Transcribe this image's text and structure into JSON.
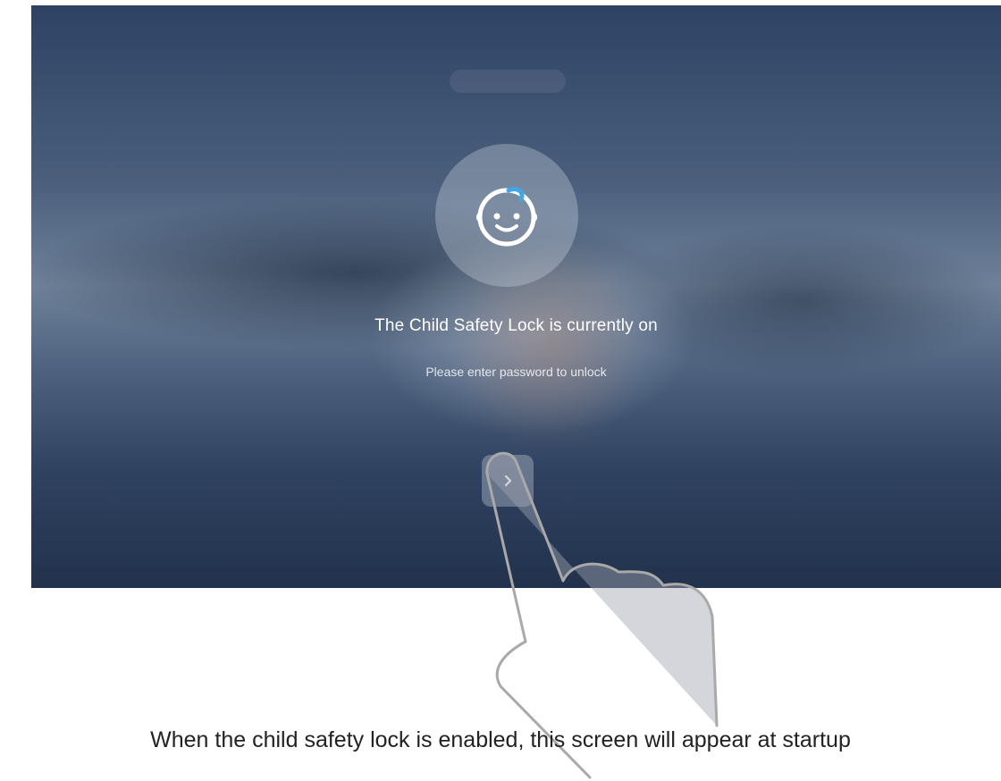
{
  "lock_screen": {
    "title": "The Child Safety Lock is currently on",
    "subtitle": "Please enter password to unlock",
    "avatar_icon": "baby-face-icon",
    "next_icon": "chevron-right-icon"
  },
  "caption": "When the child safety lock is enabled, this screen will appear at startup",
  "colors": {
    "accent": "#3fa9e8",
    "text": "#ffffff",
    "caption": "#222222"
  }
}
